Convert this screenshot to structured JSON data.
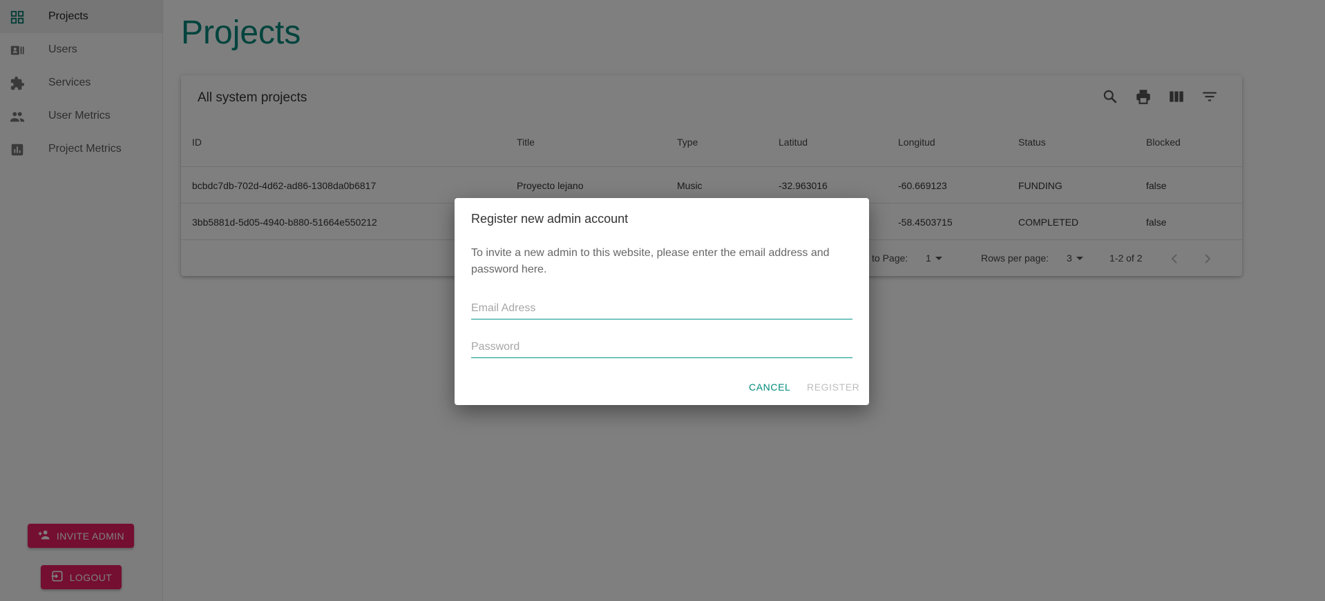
{
  "sidebar": {
    "items": [
      {
        "label": "Projects",
        "icon": "dashboard-icon",
        "active": true
      },
      {
        "label": "Users",
        "icon": "contacts-icon"
      },
      {
        "label": "Services",
        "icon": "extension-icon"
      },
      {
        "label": "User Metrics",
        "icon": "people-icon"
      },
      {
        "label": "Project Metrics",
        "icon": "bar-chart-icon"
      }
    ],
    "invite_label": "INVITE ADMIN",
    "logout_label": "LOGOUT"
  },
  "main": {
    "title": "Projects",
    "table": {
      "title": "All system projects",
      "columns": [
        "ID",
        "Title",
        "Type",
        "Latitud",
        "Longitud",
        "Status",
        "Blocked"
      ],
      "rows": [
        [
          "bcbdc7db-702d-4d62-ad86-1308da0b6817",
          "Proyecto lejano",
          "Music",
          "-32.963016",
          "-60.669123",
          "FUNDING",
          "false"
        ],
        [
          "3bb5881d-5d05-4940-b880-51664e550212",
          "",
          "",
          "",
          "-58.4503715",
          "COMPLETED",
          "false"
        ]
      ],
      "footer": {
        "goto_label": "to Page:",
        "page": "1",
        "rows_per_page_label": "Rows per page:",
        "rows_per_page": "3",
        "range": "1-2 of 2"
      }
    }
  },
  "dialog": {
    "title": "Register new admin account",
    "text": "To invite a new admin to this website, please enter the email address and password here.",
    "email_placeholder": "Email Adress",
    "password_placeholder": "Password",
    "cancel_label": "CANCEL",
    "register_label": "REGISTER"
  },
  "colors": {
    "primary": "#009688",
    "accent": "#e91e63",
    "title": "#00897b"
  }
}
